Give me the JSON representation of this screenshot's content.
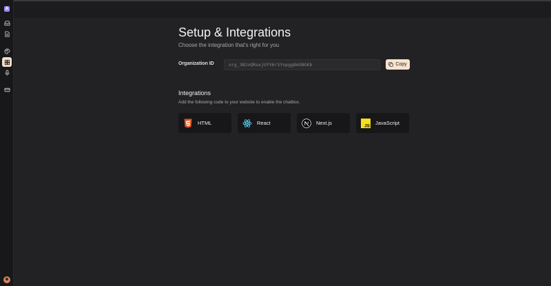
{
  "sidebar": {
    "logo_letter": "A",
    "items": [
      {
        "icon": "inbox-icon"
      },
      {
        "icon": "document-icon"
      },
      {
        "icon": "palette-icon"
      },
      {
        "icon": "grid-icon",
        "active": true
      },
      {
        "icon": "microphone-icon"
      },
      {
        "icon": "card-icon"
      }
    ],
    "active_color": "#f3dfc9"
  },
  "page": {
    "title": "Setup & Integrations",
    "subtitle": "Choose the integration that's right for you"
  },
  "organization": {
    "label": "Organization ID",
    "id_value": "org_3B2oQRsejUYV6rSYopgg8mSNGKb",
    "copy_label": "Copy"
  },
  "integrations": {
    "title": "Integrations",
    "description": "Add the following code to your website to enable the chatbox.",
    "cards": [
      {
        "label": "HTML",
        "icon": "html5-icon",
        "color": "#e34f26"
      },
      {
        "label": "React",
        "icon": "react-icon",
        "color": "#61dafb"
      },
      {
        "label": "Next.js",
        "icon": "nextjs-icon",
        "color": "#ffffff"
      },
      {
        "label": "JavaScript",
        "icon": "javascript-icon",
        "color": "#f7df1e"
      }
    ]
  },
  "colors": {
    "accent": "#f6e3cf",
    "background": "#222224"
  }
}
